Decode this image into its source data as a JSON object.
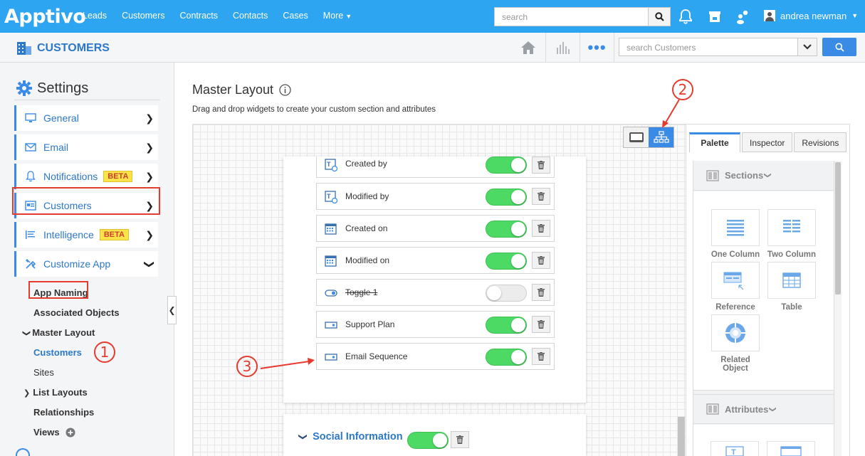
{
  "topbar": {
    "logo": "Apptivo",
    "nav": [
      "Leads",
      "Customers",
      "Contracts",
      "Contacts",
      "Cases",
      "More"
    ],
    "search_placeholder": "search",
    "user_name": "andrea newman"
  },
  "subheader": {
    "app_title": "CUSTOMERS",
    "search_placeholder": "search Customers"
  },
  "sidebar": {
    "title": "Settings",
    "items": [
      {
        "label": "General"
      },
      {
        "label": "Email"
      },
      {
        "label": "Notifications",
        "badge": "BETA"
      },
      {
        "label": "Customers"
      },
      {
        "label": "Intelligence",
        "badge": "BETA"
      },
      {
        "label": "Customize App"
      }
    ],
    "sub_items": {
      "0": {
        "label": "App Naming"
      },
      "1": {
        "label": "Associated Objects"
      },
      "2": {
        "label": "Master Layout"
      },
      "3": {
        "label": "Customers"
      },
      "4": {
        "label": "Sites"
      },
      "5": {
        "label": "List Layouts"
      },
      "6": {
        "label": "Relationships"
      },
      "7": {
        "label": "Views"
      }
    }
  },
  "main": {
    "title": "Master Layout",
    "description": "Drag and drop widgets to create your custom section and attributes",
    "fields": [
      {
        "label": "Created by",
        "enabled": true
      },
      {
        "label": "Modified by",
        "enabled": true
      },
      {
        "label": "Created on",
        "enabled": true
      },
      {
        "label": "Modified on",
        "enabled": true
      },
      {
        "label": "Toggle 1",
        "enabled": false
      },
      {
        "label": "Support Plan",
        "enabled": true
      },
      {
        "label": "Email Sequence",
        "enabled": true
      }
    ],
    "section2_title": "Social Information"
  },
  "palette": {
    "tabs": [
      "Palette",
      "Inspector",
      "Revisions"
    ],
    "sections_header": "Sections",
    "sections": [
      "One Column",
      "Two Column",
      "Reference",
      "Table",
      "Related Object"
    ],
    "attributes_header": "Attributes"
  },
  "annotations": [
    "1",
    "2",
    "3"
  ],
  "colors": {
    "brand": "#2ea5f0",
    "accent": "#3a8be6",
    "highlight": "#e53b2f",
    "toggle_on": "#4cd964"
  }
}
